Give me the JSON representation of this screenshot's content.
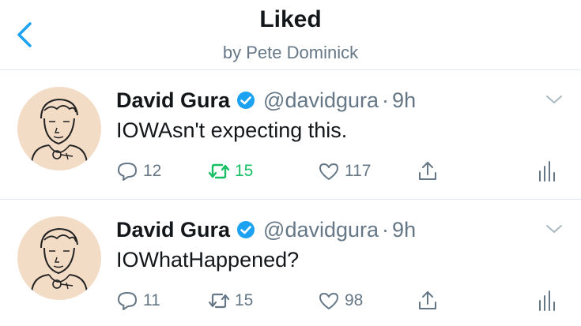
{
  "header": {
    "title": "Liked",
    "subtitle": "by Pete Dominick"
  },
  "colors": {
    "accent": "#1da1f2",
    "retweet_active": "#17bf63",
    "muted": "#657786"
  },
  "tweets": [
    {
      "author": "David Gura",
      "verified": true,
      "handle": "@davidgura",
      "time": "9h",
      "text": "IOWAsn't expecting this.",
      "replies": "12",
      "retweets": "15",
      "retweeted": true,
      "likes": "117"
    },
    {
      "author": "David Gura",
      "verified": true,
      "handle": "@davidgura",
      "time": "9h",
      "text": "IOWhatHappened?",
      "replies": "11",
      "retweets": "15",
      "retweeted": false,
      "likes": "98"
    }
  ],
  "separator": "·",
  "icons": [
    "back-chevron-icon",
    "verified-badge-icon",
    "caret-down-icon",
    "reply-icon",
    "retweet-icon",
    "like-icon",
    "share-icon",
    "analytics-icon"
  ]
}
